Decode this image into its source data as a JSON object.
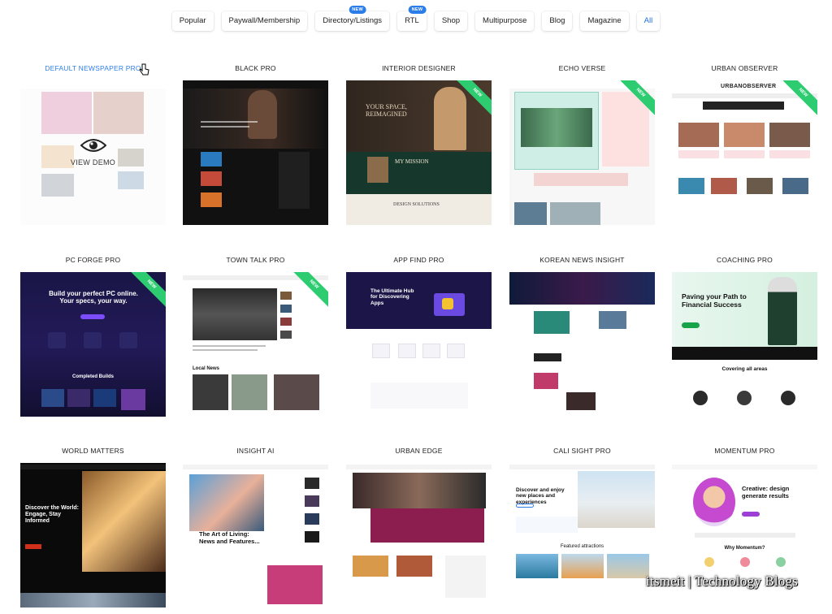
{
  "filters": [
    {
      "label": "Popular",
      "badge": ""
    },
    {
      "label": "Paywall/Membership",
      "badge": ""
    },
    {
      "label": "Directory/Listings",
      "badge": "NEW"
    },
    {
      "label": "RTL",
      "badge": "NEW"
    },
    {
      "label": "Shop",
      "badge": ""
    },
    {
      "label": "Multipurpose",
      "badge": ""
    },
    {
      "label": "Blog",
      "badge": ""
    },
    {
      "label": "Magazine",
      "badge": ""
    },
    {
      "label": "All",
      "badge": ""
    }
  ],
  "active_filter": "All",
  "colors": {
    "accent": "#2f7fe6",
    "badge": "#2b7de9",
    "ribbon": "#2ecc71"
  },
  "demos": [
    {
      "title": "DEFAULT NEWSPAPER PRO",
      "ribbon": ""
    },
    {
      "title": "BLACK PRO",
      "ribbon": ""
    },
    {
      "title": "INTERIOR DESIGNER",
      "ribbon": "NEW"
    },
    {
      "title": "ECHO VERSE",
      "ribbon": "NEW"
    },
    {
      "title": "URBAN OBSERVER",
      "ribbon": "NEW"
    },
    {
      "title": "PC FORGE PRO",
      "ribbon": "NEW"
    },
    {
      "title": "TOWN TALK PRO",
      "ribbon": "NEW"
    },
    {
      "title": "APP FIND PRO",
      "ribbon": ""
    },
    {
      "title": "KOREAN NEWS INSIGHT",
      "ribbon": ""
    },
    {
      "title": "COACHING PRO",
      "ribbon": ""
    },
    {
      "title": "WORLD MATTERS",
      "ribbon": ""
    },
    {
      "title": "INSIGHT AI",
      "ribbon": ""
    },
    {
      "title": "URBAN EDGE",
      "ribbon": ""
    },
    {
      "title": "CALI SIGHT PRO",
      "ribbon": ""
    },
    {
      "title": "MOMENTUM PRO",
      "ribbon": ""
    }
  ],
  "thumb_text": {
    "interior_hero": "YOUR SPACE, REIMAGINED",
    "interior_mission": "MY MISSION",
    "interior_design": "DESIGN SOLUTIONS",
    "urban_logo": "URBANOBSERVER",
    "pcforge_hero": "Build your perfect PC online. Your specs, your way.",
    "pcforge_builds": "Completed Builds",
    "townt_local": "Local News",
    "appfind_hero": "The Ultimate Hub for Discovering Apps",
    "coaching_hero": "Paving your Path to Financial Success",
    "coaching_areas": "Covering all areas",
    "world_hero": "Discover the World: Engage, Stay Informed",
    "insight_hero": "The Art of Living: News and Features...",
    "cali_hero": "Discover and enjoy new places and experiences",
    "cali_feat": "Featured attractions",
    "momentum_hero": "Creative: design generate results",
    "momentum_why": "Why Momentum?"
  },
  "hover": {
    "label": "VIEW DEMO",
    "icon": "eye-icon"
  },
  "watermark": "itsmeit | Technology Blogs"
}
